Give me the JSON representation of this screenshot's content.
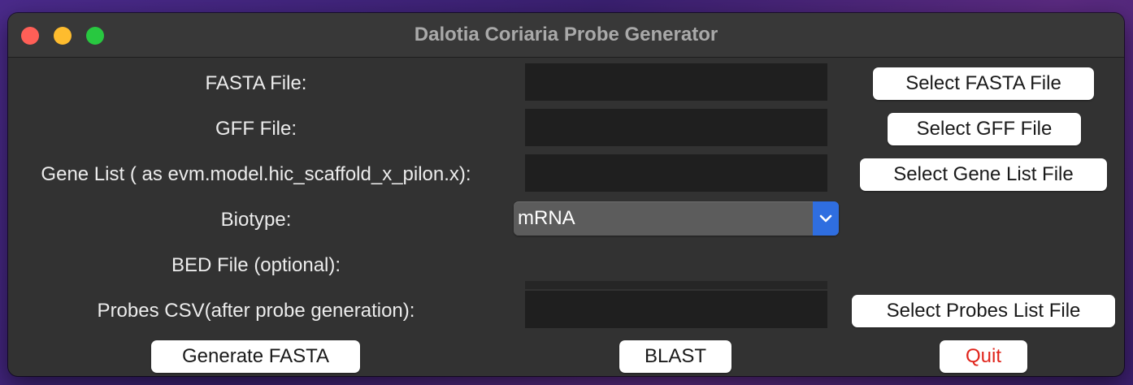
{
  "window": {
    "title": "Dalotia Coriaria Probe Generator"
  },
  "form": {
    "fasta_label": "FASTA File:",
    "fasta_value": "",
    "gff_label": "GFF File:",
    "gff_value": "",
    "gene_list_label": "Gene List ( as evm.model.hic_scaffold_x_pilon.x):",
    "gene_list_value": "",
    "biotype_label": "Biotype:",
    "biotype_selected": "mRNA",
    "bed_label": "BED File (optional):",
    "bed_value": "",
    "probes_label": "Probes CSV(after probe generation):",
    "probes_value": ""
  },
  "buttons": {
    "select_fasta": "Select FASTA File",
    "select_gff": "Select GFF File",
    "select_gene_list": "Select Gene List File",
    "select_probes": "Select Probes List File",
    "generate_fasta": "Generate FASTA",
    "blast": "BLAST",
    "quit": "Quit"
  },
  "colors": {
    "quit_text": "#e0241b",
    "select_arrow_bg": "#2f6ee0",
    "close": "#ff5f57",
    "minimize": "#febc2e",
    "maximize": "#28c840"
  },
  "icons": {
    "close": "close-icon",
    "minimize": "minimize-icon",
    "maximize": "maximize-icon",
    "dropdown": "chevron-down-icon"
  }
}
